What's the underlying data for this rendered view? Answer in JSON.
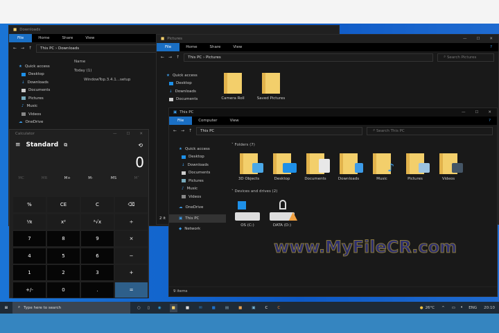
{
  "downloads_window": {
    "title": "Downloads",
    "tabs": [
      "File",
      "Home",
      "Share",
      "View"
    ],
    "path": [
      "This PC",
      "Downloads"
    ],
    "column": "Name",
    "group": "Today (1)",
    "file": "WindowTop.3.4.1...setup",
    "nav": [
      "Quick access",
      "Desktop",
      "Downloads",
      "Documents",
      "Pictures",
      "Music",
      "Videos",
      "OneDrive"
    ]
  },
  "pictures_window": {
    "title": "Pictures",
    "tabs": [
      "File",
      "Home",
      "Share",
      "View"
    ],
    "path": [
      "This PC",
      "Pictures"
    ],
    "search_placeholder": "Search Pictures",
    "folders": [
      "Camera Roll",
      "Saved Pictures"
    ],
    "nav": [
      "Quick access",
      "Desktop",
      "Downloads",
      "Documents"
    ],
    "status": "2 it"
  },
  "thispc_window": {
    "title": "This PC",
    "tabs": [
      "File",
      "Computer",
      "View"
    ],
    "path": [
      "This PC"
    ],
    "search_placeholder": "Search This PC",
    "nav": [
      "Quick access",
      "Desktop",
      "Downloads",
      "Documents",
      "Pictures",
      "Music",
      "Videos",
      "OneDrive",
      "This PC",
      "Network"
    ],
    "folders_header": "Folders (7)",
    "folders": [
      "3D Objects",
      "Desktop",
      "Documents",
      "Downloads",
      "Music",
      "Pictures",
      "Videos"
    ],
    "drives_header": "Devices and drives (2)",
    "drives": [
      "OS (C:)",
      "DATA (D:)"
    ],
    "status": "9 items"
  },
  "calculator": {
    "title": "Calculator",
    "mode": "Standard",
    "display": "0",
    "memory": [
      "MC",
      "MR",
      "M+",
      "M-",
      "MS",
      "M˅"
    ],
    "keys": [
      "%",
      "CE",
      "C",
      "⌫",
      "¹⁄x",
      "x²",
      "²√x",
      "÷",
      "7",
      "8",
      "9",
      "×",
      "4",
      "5",
      "6",
      "−",
      "1",
      "2",
      "3",
      "+",
      "+/-",
      "0",
      ".",
      "="
    ]
  },
  "taskbar": {
    "search_placeholder": "Type here to search",
    "weather": "26°C",
    "language": "ENG",
    "time": "20:10"
  },
  "watermark": "www.MyFileCR.com",
  "colors": {
    "accent": "#1a6fc4",
    "desktop": "#0d59c6",
    "equals": "#2e5f8a"
  }
}
